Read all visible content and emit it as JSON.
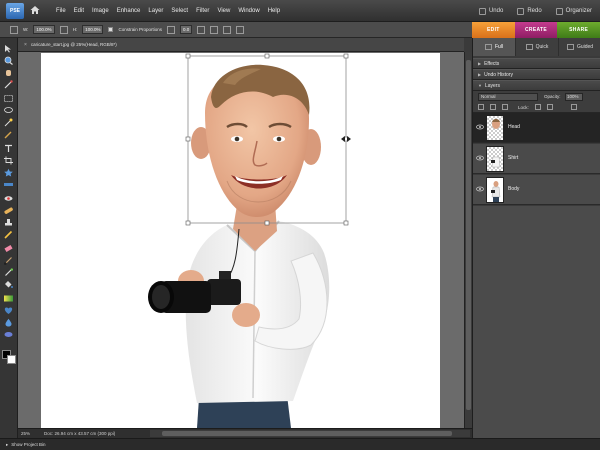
{
  "app": {
    "logo_text": "PSE"
  },
  "menu": [
    "File",
    "Edit",
    "Image",
    "Enhance",
    "Layer",
    "Select",
    "Filter",
    "View",
    "Window",
    "Help"
  ],
  "right_tools": {
    "undo": "Undo",
    "redo": "Redo",
    "organizer": "Organizer"
  },
  "options": {
    "w_label": "W:",
    "w_value": "100.0%",
    "h_label": "H:",
    "h_value": "100.0%",
    "constrain": "Constrain Proportions",
    "rotate_value": "0.0"
  },
  "modes": {
    "edit": "EDIT",
    "create": "CREATE",
    "share": "SHARE",
    "active": "edit"
  },
  "views": [
    {
      "label": "Full",
      "active": true
    },
    {
      "label": "Quick",
      "active": false
    },
    {
      "label": "Guided",
      "active": false
    }
  ],
  "document": {
    "title": "caricature_start.jpg @ 25%(Head, RGB/8*)",
    "zoom": "25%",
    "info": "Doc: 26.94 cm x 43.57 cm (300 ppi)"
  },
  "panels": {
    "effects": "Effects",
    "undo_history": "Undo History",
    "layers": "Layers"
  },
  "layers_panel": {
    "blend_mode": "Normal",
    "opacity_label": "Opacity:",
    "opacity_value": "100%",
    "lock_label": "Lock:"
  },
  "layers": [
    {
      "name": "Head",
      "selected": true
    },
    {
      "name": "Shirt",
      "selected": false
    },
    {
      "name": "Body",
      "selected": false
    }
  ],
  "project_bin": "Show Project Bin",
  "colors": {
    "edit": "#e8862a",
    "create": "#a8297a",
    "share": "#559522",
    "selection": "#242424"
  }
}
